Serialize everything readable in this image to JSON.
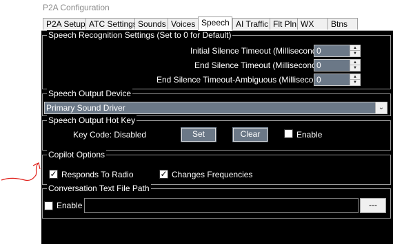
{
  "window": {
    "title": "P2A Configuration"
  },
  "tabs": [
    {
      "label": "P2A Setup",
      "active": false
    },
    {
      "label": "ATC Settings",
      "active": false
    },
    {
      "label": "Sounds",
      "active": false
    },
    {
      "label": "Voices",
      "active": false
    },
    {
      "label": "Speech",
      "active": true
    },
    {
      "label": "AI Traffic",
      "active": false
    },
    {
      "label": "Flt Pln",
      "active": false
    },
    {
      "label": "WX",
      "active": false
    },
    {
      "label": "Btns",
      "active": false
    }
  ],
  "speech_recognition": {
    "title": "Speech Recognition Settings (Set to 0 for Default)",
    "initial_label": "Initial Silence Timeout (Milliseconds)",
    "initial_value": "0",
    "end_label": "End Silence Timeout (Milliseconds)",
    "end_value": "0",
    "ambig_label": "End Silence Timeout-Ambiguous (Milliseconds)",
    "ambig_value": "0"
  },
  "speech_output_device": {
    "title": "Speech Output Device",
    "selected": "Primary Sound Driver"
  },
  "hotkey": {
    "title": "Speech Output Hot Key",
    "key_code": "Key Code: Disabled",
    "set_label": "Set",
    "clear_label": "Clear",
    "enable_label": "Enable",
    "enable_checked": false
  },
  "copilot": {
    "title": "Copilot Options",
    "responds_label": "Responds To Radio",
    "responds_checked": true,
    "freq_label": "Changes Frequencies",
    "freq_checked": true
  },
  "conversation": {
    "title": "Conversation Text File Path",
    "enable_label": "Enable",
    "enable_checked": false,
    "path_value": "",
    "browse_label": "---"
  },
  "colors": {
    "panel_bg": "#000000",
    "control_fill": "#6b7887",
    "annotation": "#e0201a"
  }
}
